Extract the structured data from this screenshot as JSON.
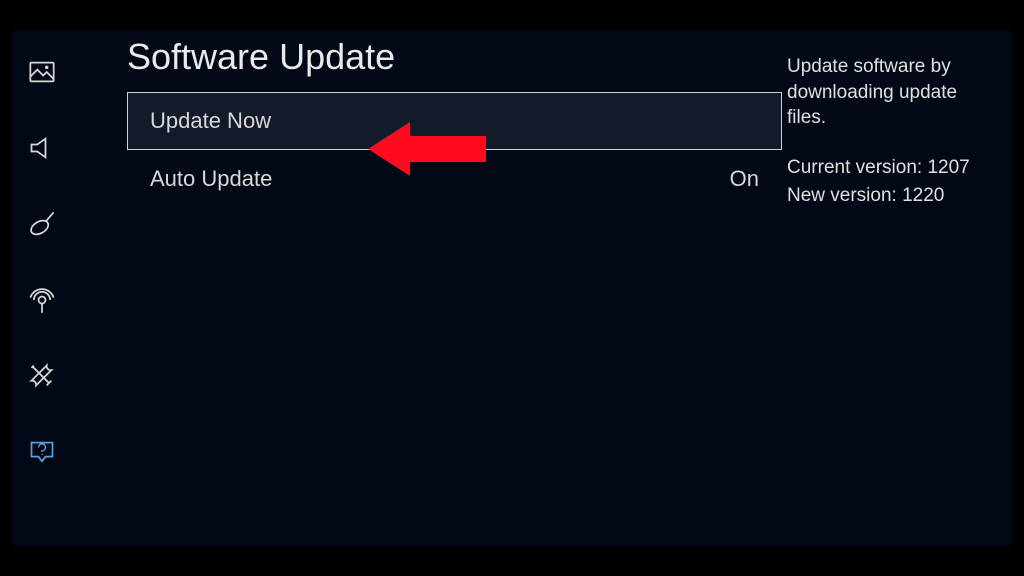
{
  "page_title": "Software Update",
  "menu_items": [
    {
      "label": "Update Now",
      "value": "",
      "selected": true
    },
    {
      "label": "Auto Update",
      "value": "On",
      "selected": false
    }
  ],
  "info": {
    "description": "Update software by downloading update files.",
    "current_version_label": "Current version:",
    "current_version": "1207",
    "new_version_label": "New version:",
    "new_version": "1220"
  },
  "sidebar": {
    "items": [
      {
        "name": "picture",
        "active": false
      },
      {
        "name": "sound",
        "active": false
      },
      {
        "name": "broadcasting",
        "active": false
      },
      {
        "name": "network",
        "active": false
      },
      {
        "name": "system-tools",
        "active": false
      },
      {
        "name": "support",
        "active": true
      }
    ]
  }
}
